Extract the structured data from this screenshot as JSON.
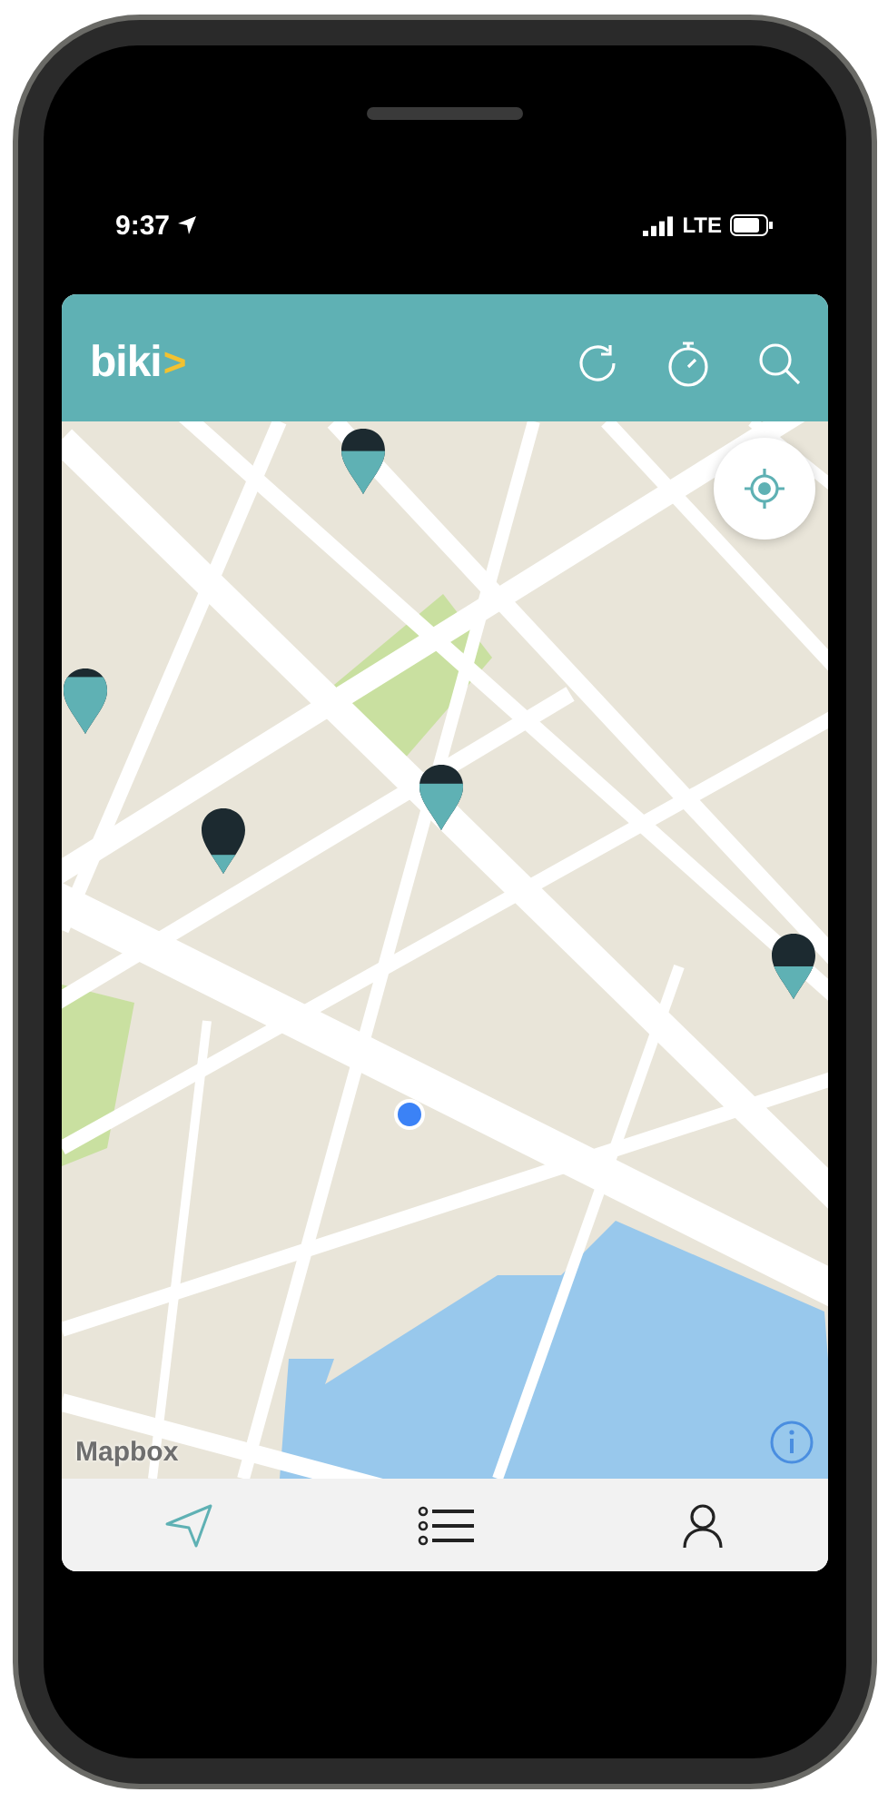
{
  "status_bar": {
    "time": "9:37",
    "network": "LTE"
  },
  "header": {
    "logo": "biki",
    "logo_mark": ">"
  },
  "map": {
    "attribution": "Mapbox",
    "stations": [
      {
        "level": 0.65
      },
      {
        "level": 0.85
      },
      {
        "level": 0.3
      },
      {
        "level": 0.7
      },
      {
        "level": 0.5
      }
    ]
  },
  "nav": [
    {
      "kind": "map",
      "selected": true
    },
    {
      "kind": "list",
      "selected": false
    },
    {
      "kind": "profile",
      "selected": false
    }
  ]
}
